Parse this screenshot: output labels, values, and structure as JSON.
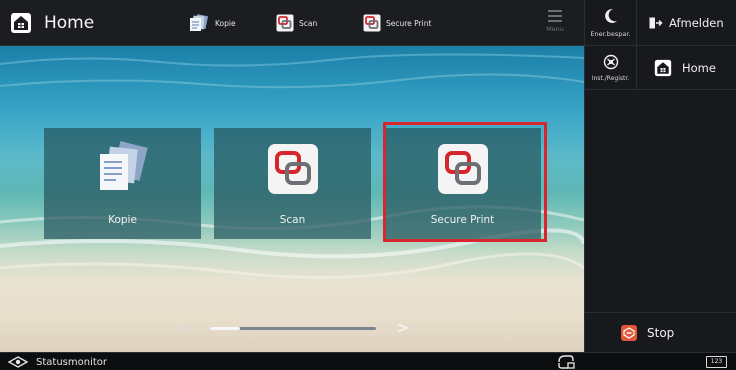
{
  "header": {
    "title": "Home",
    "shortcuts": [
      {
        "label": "Kopie",
        "icon": "copy-icon"
      },
      {
        "label": "Scan",
        "icon": "scan-icon"
      },
      {
        "label": "Secure Print",
        "icon": "secure-print-icon"
      }
    ],
    "menu_label": "Menu"
  },
  "side_panel": {
    "energy_label": "Ener.bespar.",
    "logout_label": "Afmelden",
    "settings_label": "Inst./Registr.",
    "home_label": "Home",
    "stop_label": "Stop"
  },
  "tiles": [
    {
      "label": "Kopie",
      "icon": "copy-icon"
    },
    {
      "label": "Scan",
      "icon": "scan-icon"
    },
    {
      "label": "Secure Print",
      "icon": "secure-print-icon",
      "selected": true
    }
  ],
  "pagination": {
    "prev": "<",
    "next": ">",
    "position_fraction": 0.18
  },
  "footer": {
    "status_label": "Statusmonitor",
    "keypad_label": "123"
  },
  "colors": {
    "accent_red": "#d8262f",
    "stop_orange": "#e2563a",
    "panel_dark": "#17191c"
  }
}
